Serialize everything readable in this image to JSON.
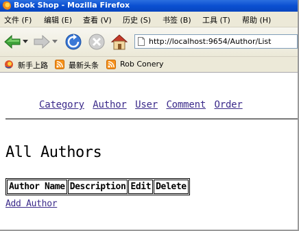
{
  "window": {
    "title": "Book Shop - Mozilla Firefox"
  },
  "menu": {
    "items": [
      {
        "label": "文件 (F)"
      },
      {
        "label": "编辑 (E)"
      },
      {
        "label": "查看 (V)"
      },
      {
        "label": "历史 (S)"
      },
      {
        "label": "书签 (B)"
      },
      {
        "label": "工具 (T)"
      },
      {
        "label": "帮助 (H)"
      }
    ]
  },
  "navigation": {
    "url": "http://localhost:9654/Author/List"
  },
  "bookmarks": {
    "items": [
      {
        "label": "新手上路",
        "icon": "firefox-bookmark-icon"
      },
      {
        "label": "最新头条",
        "icon": "rss-feed-icon"
      },
      {
        "label": "Rob Conery",
        "icon": "rss-feed-icon"
      }
    ]
  },
  "page": {
    "nav_links": [
      "Category",
      "Author",
      "User",
      "Comment",
      "Order"
    ],
    "heading": "All Authors",
    "table": {
      "headers": [
        "Author Name",
        "Description",
        "Edit",
        "Delete"
      ]
    },
    "add_link": "Add Author"
  },
  "colors": {
    "titlebar": "#0a4fd1",
    "chrome": "#ece9d8",
    "link": "#3b2a8a"
  }
}
